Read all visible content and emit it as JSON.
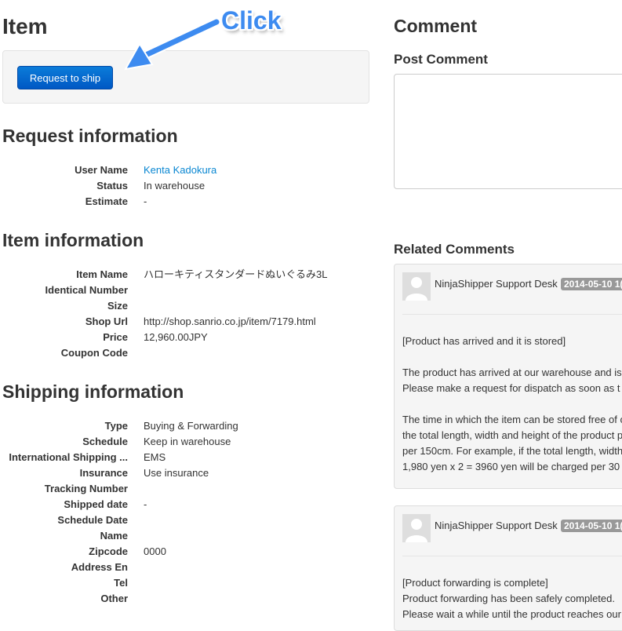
{
  "annotation": {
    "click_label": "Click"
  },
  "item": {
    "title": "Item",
    "request_button": "Request to ship"
  },
  "request_info": {
    "title": "Request information",
    "rows": [
      {
        "label": "User Name",
        "value": "Kenta Kadokura"
      },
      {
        "label": "Status",
        "value": "In warehouse"
      },
      {
        "label": "Estimate",
        "value": "-"
      }
    ]
  },
  "item_info": {
    "title": "Item information",
    "rows": [
      {
        "label": "Item Name",
        "value": "ハローキティスタンダードぬいぐるみ3L"
      },
      {
        "label": "Identical Number",
        "value": ""
      },
      {
        "label": "Size",
        "value": ""
      },
      {
        "label": "Shop Url",
        "value": "http://shop.sanrio.co.jp/item/7179.html"
      },
      {
        "label": "Price",
        "value": "12,960.00JPY"
      },
      {
        "label": "Coupon Code",
        "value": ""
      }
    ]
  },
  "shipping_info": {
    "title": "Shipping information",
    "rows": [
      {
        "label": "Type",
        "value": "Buying & Forwarding"
      },
      {
        "label": "Schedule",
        "value": "Keep in warehouse"
      },
      {
        "label": "International Shipping ...",
        "value": "EMS"
      },
      {
        "label": "Insurance",
        "value": "Use insurance"
      },
      {
        "label": "Tracking Number",
        "value": ""
      },
      {
        "label": "Shipped date",
        "value": "-"
      },
      {
        "label": "Schedule Date",
        "value": ""
      },
      {
        "label": "Name",
        "value": ""
      },
      {
        "label": "Zipcode",
        "value": "0000"
      },
      {
        "label": "Address En",
        "value": ""
      },
      {
        "label": "Tel",
        "value": ""
      },
      {
        "label": "Other",
        "value": ""
      }
    ]
  },
  "comment": {
    "title": "Comment",
    "post_title": "Post Comment",
    "textarea_value": "",
    "related_title": "Related Comments"
  },
  "related_comments": [
    {
      "author": "NinjaShipper Support Desk",
      "date": "2014-05-10 1(",
      "lines": [
        "[Product has arrived and it is stored]",
        "",
        "The product has arrived at our warehouse and is",
        "Please make a request for dispatch as soon as t",
        "",
        "The time in which the item can be stored free of c",
        "the total length, width and height of the product p",
        "per 150cm. For example, if the total length, width",
        "1,980 yen x 2 = 3960 yen will be charged per 30"
      ]
    },
    {
      "author": "NinjaShipper Support Desk",
      "date": "2014-05-10 1(",
      "lines": [
        "[Product forwarding is complete]",
        "Product forwarding has been safely completed.",
        "Please wait a while until the product reaches our"
      ]
    }
  ]
}
